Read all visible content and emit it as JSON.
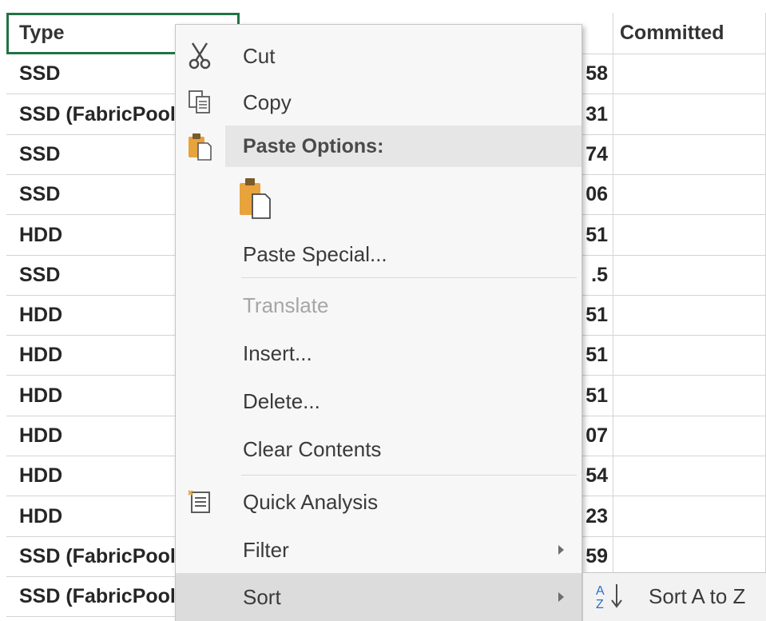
{
  "sheet": {
    "col_a_header": "Type",
    "col_c_header": "Committed",
    "rows": [
      {
        "type": "SSD",
        "num": "58"
      },
      {
        "type": "SSD (FabricPool)",
        "num": "31"
      },
      {
        "type": "SSD",
        "num": "74"
      },
      {
        "type": "SSD",
        "num": "06"
      },
      {
        "type": "HDD",
        "num": "51"
      },
      {
        "type": "SSD",
        "num": ".5"
      },
      {
        "type": "HDD",
        "num": "51"
      },
      {
        "type": "HDD",
        "num": "51"
      },
      {
        "type": "HDD",
        "num": "51"
      },
      {
        "type": "HDD",
        "num": "07"
      },
      {
        "type": "HDD",
        "num": "54"
      },
      {
        "type": "HDD",
        "num": "23"
      },
      {
        "type": "SSD (FabricPool)",
        "num": "59"
      },
      {
        "type": "SSD (FabricPool)",
        "num": ""
      }
    ]
  },
  "menu": {
    "cut": "Cut",
    "copy": "Copy",
    "paste_options": "Paste Options:",
    "paste_special": "Paste Special...",
    "translate": "Translate",
    "insert": "Insert...",
    "delete": "Delete...",
    "clear_contents": "Clear Contents",
    "quick_analysis": "Quick Analysis",
    "filter": "Filter",
    "sort": "Sort"
  },
  "submenu": {
    "sort_a_to_z": "Sort A to Z"
  },
  "icons": {
    "cut": "scissors-icon",
    "copy": "copy-icon",
    "paste": "clipboard-icon",
    "quick_analysis": "quick-analysis-icon",
    "sort": "sort-az-icon"
  },
  "colors": {
    "selection": "#217346",
    "paste_orange": "#e8a33c",
    "hover": "#dcdcdc"
  }
}
